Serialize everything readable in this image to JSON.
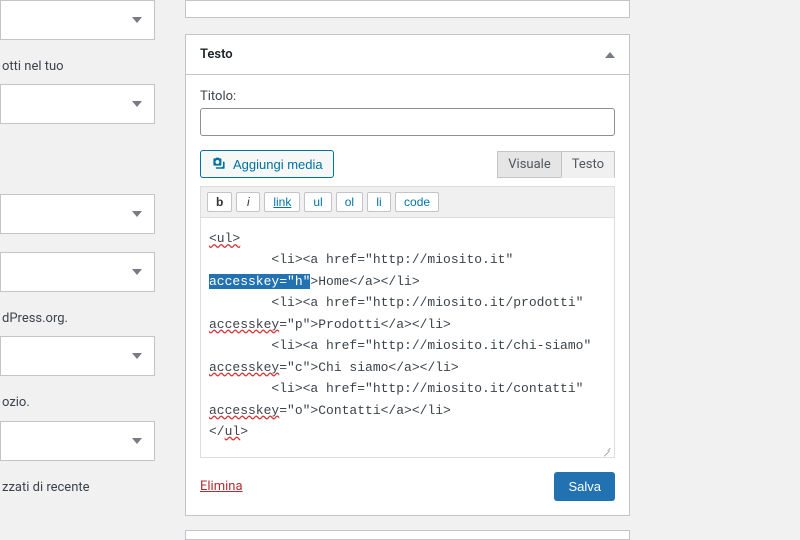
{
  "sidebar": {
    "text1": "otti nel tuo",
    "text2": "dPress.org.",
    "text3": "ozio.",
    "text4": "zzati di recente"
  },
  "widget": {
    "title": "Testo",
    "title_field_label": "Titolo:",
    "title_value": "",
    "add_media": "Aggiungi media",
    "tab_visual": "Visuale",
    "tab_text": "Testo",
    "toolbar": {
      "b": "b",
      "i": "i",
      "link": "link",
      "ul": "ul",
      "ol": "ol",
      "li": "li",
      "code": "code"
    },
    "editor": {
      "l0": "<ul>",
      "l1a": "        <li><a href=\"http://miosito.it\" ",
      "l1b_hl": "accesskey=\"h\"",
      "l1c": ">Home</a></li>",
      "l2a": "        <li><a href=\"http://miosito.it/prodotti\" ",
      "l2b": "accesskey",
      "l2c": "=\"p\">Prodotti</a></li>",
      "l3a": "        <li><a href=\"http://miosito.it/chi-siamo\" ",
      "l3b": "accesskey",
      "l3c": "=\"c\">Chi siamo</a></li>",
      "l4a": "        <li><a href=\"http://miosito.it/contatti\" ",
      "l4b": "accesskey",
      "l4c": "=\"o\">Contatti</a></li>",
      "l5a": "</",
      "l5b": "ul",
      "l5c": ">"
    },
    "delete": "Elimina",
    "save": "Salva"
  }
}
